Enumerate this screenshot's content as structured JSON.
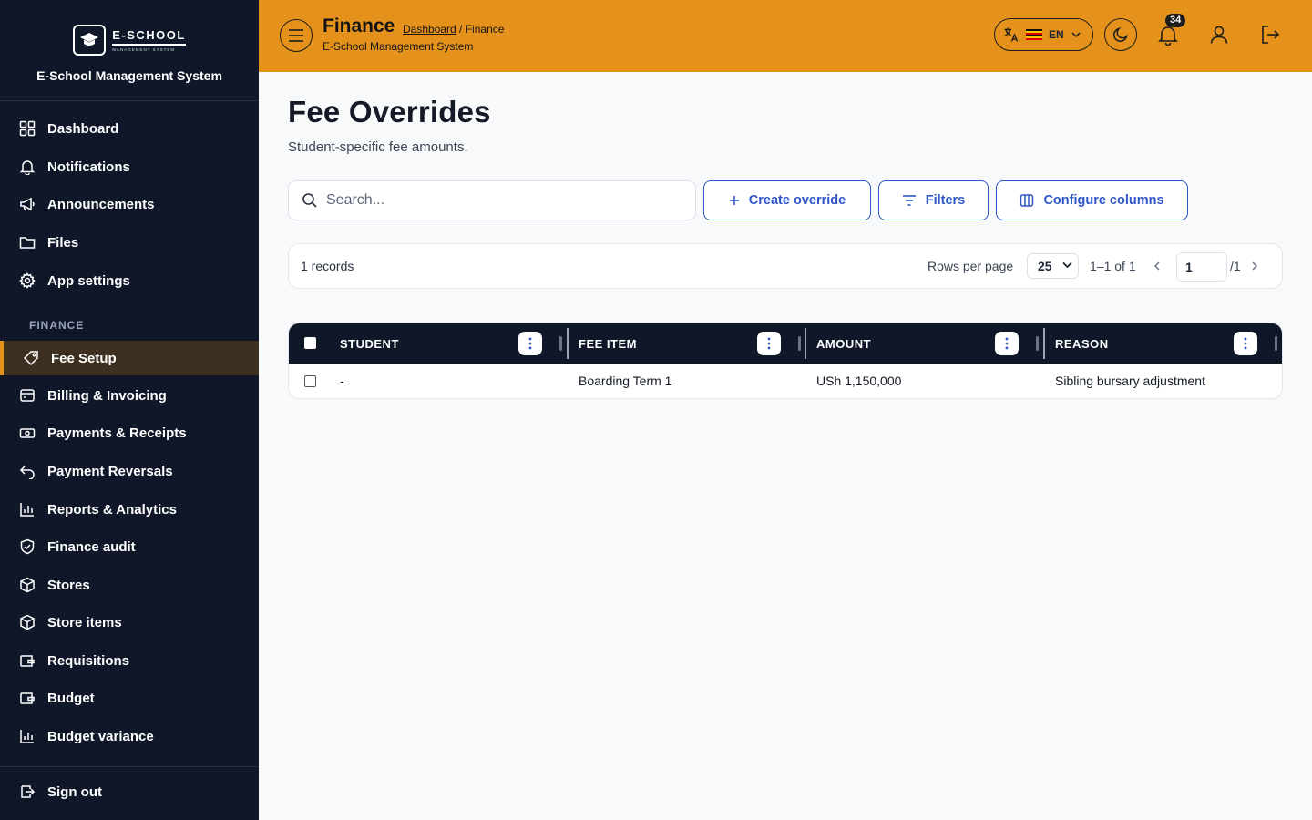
{
  "brand": {
    "logo_main": "E-SCHOOL",
    "logo_sub": "MANAGEMENT SYSTEM",
    "name": "E-School Management System"
  },
  "sidebar": {
    "items_top": [
      {
        "label": "Dashboard",
        "icon": "grid-icon"
      },
      {
        "label": "Notifications",
        "icon": "bell-icon"
      },
      {
        "label": "Announcements",
        "icon": "megaphone-icon"
      },
      {
        "label": "Files",
        "icon": "folder-icon"
      },
      {
        "label": "App settings",
        "icon": "gear-icon"
      }
    ],
    "section_label": "FINANCE",
    "items_finance": [
      {
        "label": "Fee Setup",
        "icon": "tag-icon",
        "active": true
      },
      {
        "label": "Billing & Invoicing",
        "icon": "invoice-icon"
      },
      {
        "label": "Payments & Receipts",
        "icon": "cash-icon"
      },
      {
        "label": "Payment Reversals",
        "icon": "undo-icon"
      },
      {
        "label": "Reports & Analytics",
        "icon": "bar-chart-icon"
      },
      {
        "label": "Finance audit",
        "icon": "shield-check-icon"
      },
      {
        "label": "Stores",
        "icon": "box-icon"
      },
      {
        "label": "Store items",
        "icon": "box-icon"
      },
      {
        "label": "Requisitions",
        "icon": "wallet-icon"
      },
      {
        "label": "Budget",
        "icon": "wallet-icon"
      },
      {
        "label": "Budget variance",
        "icon": "bar-chart-icon"
      }
    ],
    "sign_out": "Sign out"
  },
  "header": {
    "title": "Finance",
    "breadcrumb_link": "Dashboard",
    "breadcrumb_rest": " / Finance",
    "subtitle": "E-School Management System",
    "lang_code": "EN",
    "notification_count": "34",
    "accent_color": "#e4921c"
  },
  "main": {
    "title": "Fee Overrides",
    "subtitle": "Student-specific fee amounts.",
    "search_placeholder": "Search...",
    "buttons": {
      "create": "Create override",
      "filters": "Filters",
      "configure": "Configure columns"
    }
  },
  "pagination": {
    "records": "1 records",
    "rows_per_page_label": "Rows per page",
    "rows_per_page": "25",
    "range": "1–1 of 1",
    "page": "1",
    "total_pages": "/1"
  },
  "table": {
    "columns": [
      "STUDENT",
      "FEE ITEM",
      "AMOUNT",
      "REASON"
    ],
    "rows": [
      {
        "student": "-",
        "fee_item": "Boarding Term 1",
        "amount": "USh 1,150,000",
        "reason": "Sibling bursary adjustment"
      }
    ]
  }
}
